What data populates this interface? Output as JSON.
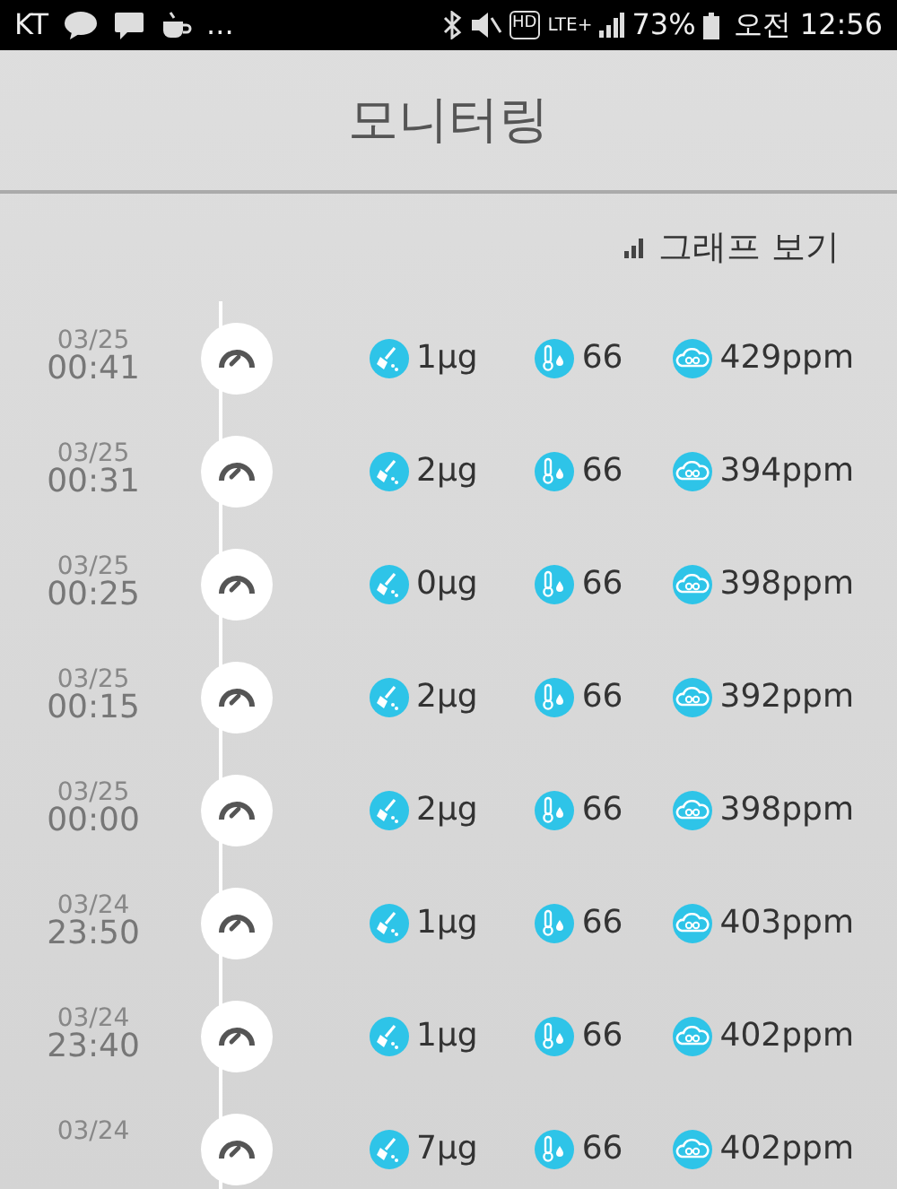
{
  "status_bar": {
    "carrier": "KT",
    "more": "...",
    "hd": "HD",
    "network": "LTE+",
    "battery": "73%",
    "time": "오전 12:56"
  },
  "header": {
    "title": "모니터링"
  },
  "graph_link": {
    "label": "그래프 보기"
  },
  "records": [
    {
      "date": "03/25",
      "time": "00:41",
      "dust": "1µg",
      "humidity": "66",
      "co2": "429ppm"
    },
    {
      "date": "03/25",
      "time": "00:31",
      "dust": "2µg",
      "humidity": "66",
      "co2": "394ppm"
    },
    {
      "date": "03/25",
      "time": "00:25",
      "dust": "0µg",
      "humidity": "66",
      "co2": "398ppm"
    },
    {
      "date": "03/25",
      "time": "00:15",
      "dust": "2µg",
      "humidity": "66",
      "co2": "392ppm"
    },
    {
      "date": "03/25",
      "time": "00:00",
      "dust": "2µg",
      "humidity": "66",
      "co2": "398ppm"
    },
    {
      "date": "03/24",
      "time": "23:50",
      "dust": "1µg",
      "humidity": "66",
      "co2": "403ppm"
    },
    {
      "date": "03/24",
      "time": "23:40",
      "dust": "1µg",
      "humidity": "66",
      "co2": "402ppm"
    },
    {
      "date": "03/24",
      "dust": "7µg",
      "humidity": "66",
      "co2": "402ppm"
    }
  ]
}
